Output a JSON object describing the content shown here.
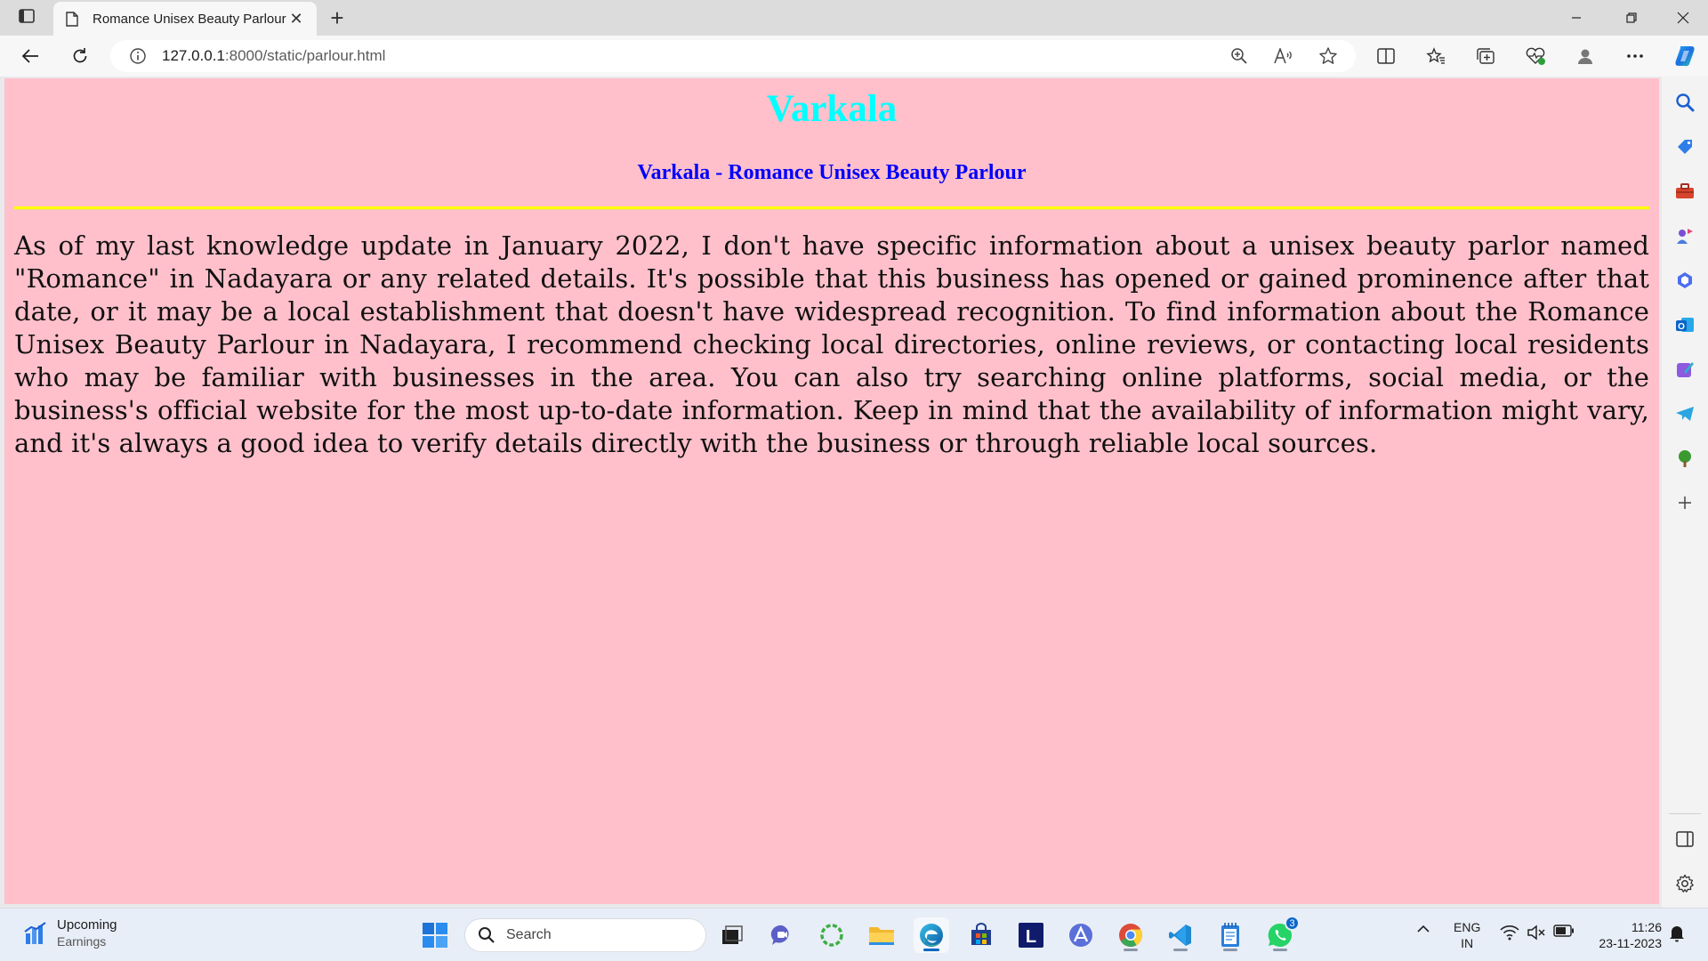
{
  "browser": {
    "tab_title": "Romance Unisex Beauty Parlour",
    "url_host": "127.0.0.1",
    "url_rest": ":8000/static/parlour.html"
  },
  "page": {
    "title": "Varkala",
    "subtitle": "Varkala - Romance Unisex Beauty Parlour",
    "body": "As of my last knowledge update in January 2022, I don't have specific information about a unisex beauty parlor named \"Romance\" in Nadayara or any related details. It's possible that this business has opened or gained prominence after that date, or it may be a local establishment that doesn't have widespread recognition. To find information about the Romance Unisex Beauty Parlour in Nadayara, I recommend checking local directories, online reviews, or contacting local residents who may be familiar with businesses in the area. You can also try searching online platforms, social media, or the business's official website for the most up-to-date information. Keep in mind that the availability of information might vary, and it's always a good idea to verify details directly with the business or through reliable local sources.",
    "colors": {
      "background": "#ffc0cb",
      "title": "#00ffff",
      "subtitle": "#0000ff",
      "rule": "#ffff00"
    }
  },
  "taskbar": {
    "weather_line1": "Upcoming",
    "weather_line2": "Earnings",
    "search_label": "Search",
    "whatsapp_badge": "3",
    "lang_line1": "ENG",
    "lang_line2": "IN",
    "time": "11:26",
    "date": "23-11-2023"
  },
  "icons": {
    "tabstrip": [
      "tab-actions-icon",
      "page-favicon-icon",
      "close-icon",
      "plus-icon",
      "minimize-icon",
      "maximize-icon",
      "close-window-icon"
    ],
    "toolbar": [
      "back-arrow-icon",
      "refresh-icon",
      "info-icon",
      "zoom-icon",
      "read-aloud-icon",
      "favorite-star-icon",
      "split-screen-icon",
      "favorites-icon",
      "collections-icon",
      "browser-essentials-icon",
      "profile-icon",
      "more-icon",
      "copilot-icon"
    ],
    "sidebar": [
      "search-icon",
      "shopping-icon",
      "tools-icon",
      "games-icon",
      "microsoft365-icon",
      "outlook-icon",
      "designer-icon",
      "telegram-icon",
      "tree-icon",
      "add-icon",
      "sidebar-toggle-icon",
      "settings-icon"
    ]
  }
}
